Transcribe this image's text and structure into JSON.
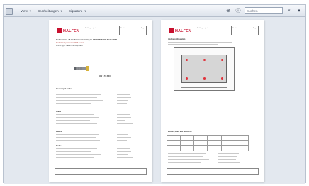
{
  "toolbar": {
    "menus": [
      {
        "label": "View"
      },
      {
        "label": "Bearbeitungen"
      },
      {
        "label": "Signature"
      }
    ],
    "search": {
      "value": "Suchen"
    }
  },
  "page1": {
    "company": "HALFEN",
    "header": {
      "project": "Building project",
      "position": "Position",
      "page": "Page",
      "program": "Program no."
    },
    "title": "Calculation of anchors according to CEN/TS 1992-4-1/2:2009",
    "subtitle": "Product and parameters HCS Anchor",
    "subtitle2": "Anchor type: Halfen Anchor product",
    "product_label": "HCS 7.7/1.5 XX",
    "sections": {
      "geometry": "Geometry of anchor",
      "loads": "Loads",
      "material": "Material",
      "profile": "Profile"
    }
  },
  "page2": {
    "company": "HALFEN",
    "header": {
      "project": "Building project",
      "position": "Position",
      "page": "Page",
      "program": "Program no."
    },
    "section_title": "Anchor configuration",
    "table_title": "Existing loads and resistance"
  }
}
